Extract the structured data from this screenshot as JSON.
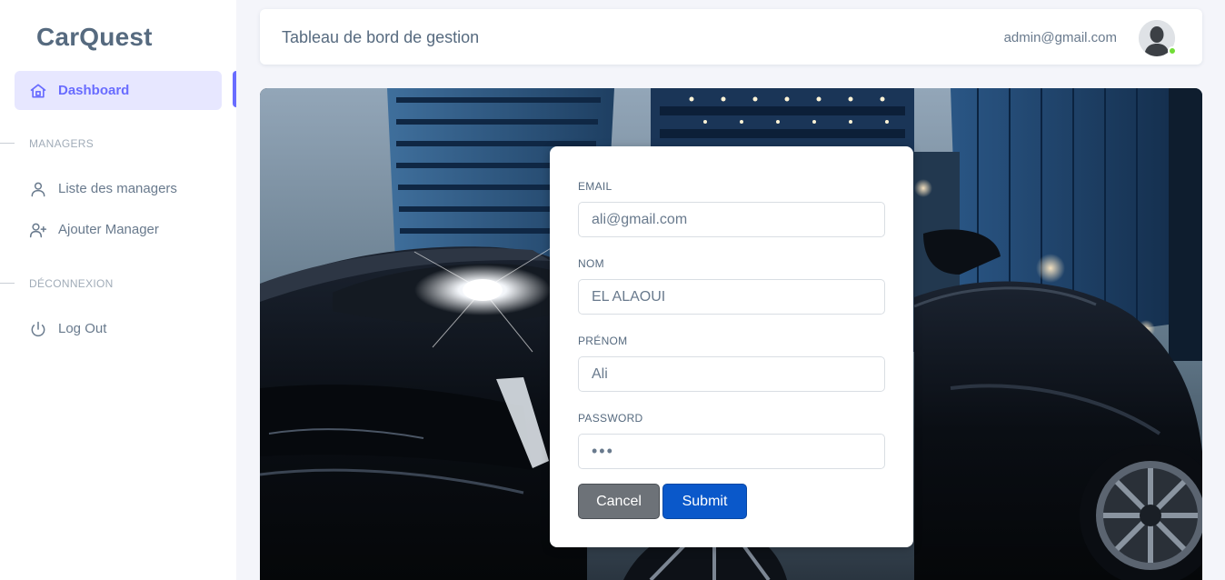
{
  "brand": {
    "name": "CarQuest"
  },
  "sidebar": {
    "items": [
      {
        "label": "Dashboard",
        "icon": "home-icon",
        "active": true
      }
    ],
    "sections": [
      {
        "header": "MANAGERS",
        "items": [
          {
            "label": "Liste des managers",
            "icon": "user-icon"
          },
          {
            "label": "Ajouter Manager",
            "icon": "user-plus-icon"
          }
        ]
      },
      {
        "header": "DÉCONNEXION",
        "items": [
          {
            "label": "Log Out",
            "icon": "power-icon"
          }
        ]
      }
    ]
  },
  "navbar": {
    "title": "Tableau de bord de gestion",
    "email": "admin@gmail.com",
    "status": "online"
  },
  "form": {
    "email_label": "EMAIL",
    "email_value": "ali@gmail.com",
    "nom_label": "NOM",
    "nom_value": "EL ALAOUI",
    "prenom_label": "PRÉNOM",
    "prenom_value": "Ali",
    "password_label": "PASSWORD",
    "password_value": "•••",
    "cancel_label": "Cancel",
    "submit_label": "Submit"
  },
  "colors": {
    "accent": "#696cff",
    "active_bg": "#e7e7ff",
    "submit": "#0a58ca",
    "cancel": "#6d7278",
    "online": "#71dd37"
  }
}
